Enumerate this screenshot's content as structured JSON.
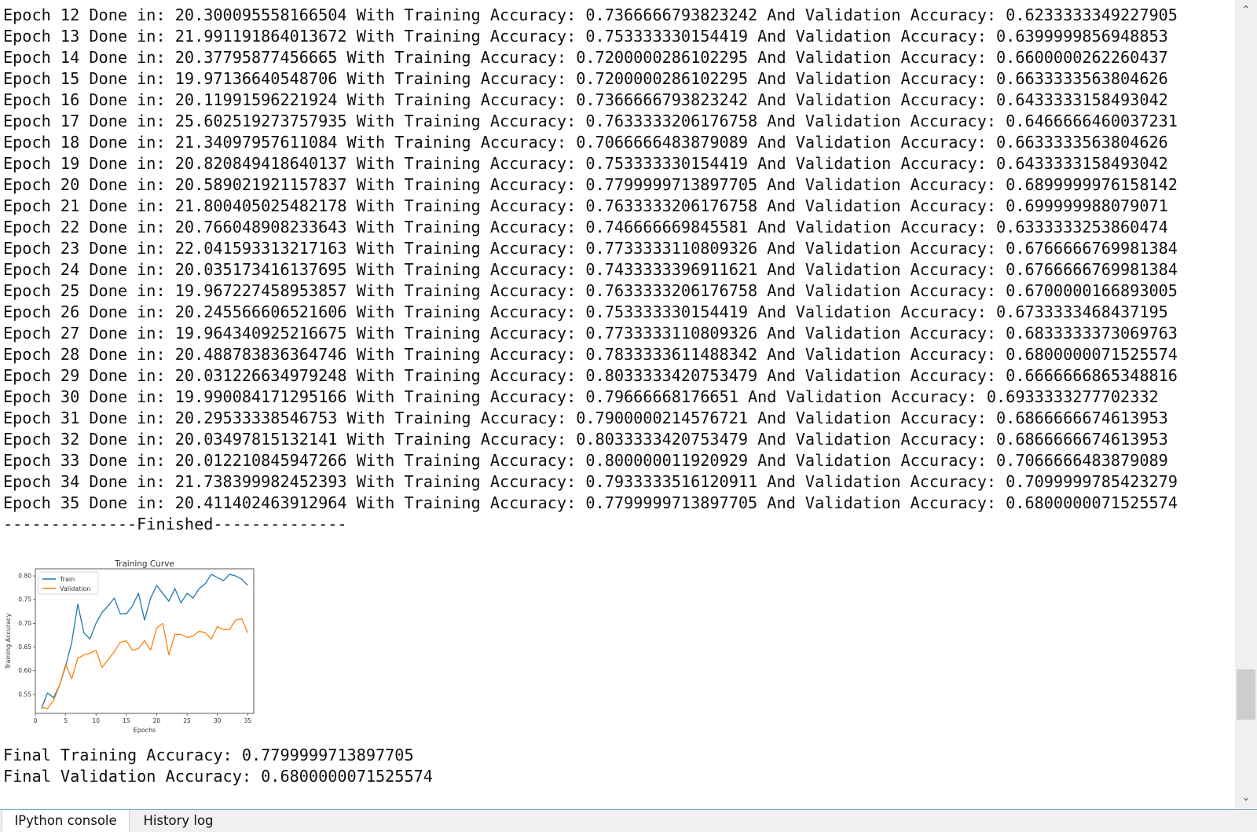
{
  "console": {
    "epoch_lines": [
      "Epoch 12 Done in: 20.300095558166504 With Training Accuracy: 0.7366666793823242 And Validation Accuracy: 0.6233333349227905",
      "Epoch 13 Done in: 21.991191864013672 With Training Accuracy: 0.753333330154419 And Validation Accuracy: 0.6399999856948853",
      "Epoch 14 Done in: 20.37795877456665 With Training Accuracy: 0.7200000286102295 And Validation Accuracy: 0.6600000262260437",
      "Epoch 15 Done in: 19.97136640548706 With Training Accuracy: 0.7200000286102295 And Validation Accuracy: 0.6633333563804626",
      "Epoch 16 Done in: 20.11991596221924 With Training Accuracy: 0.7366666793823242 And Validation Accuracy: 0.6433333158493042",
      "Epoch 17 Done in: 25.602519273757935 With Training Accuracy: 0.7633333206176758 And Validation Accuracy: 0.6466666460037231",
      "Epoch 18 Done in: 21.34097957611084 With Training Accuracy: 0.7066666483879089 And Validation Accuracy: 0.6633333563804626",
      "Epoch 19 Done in: 20.820849418640137 With Training Accuracy: 0.753333330154419 And Validation Accuracy: 0.6433333158493042",
      "Epoch 20 Done in: 20.589021921157837 With Training Accuracy: 0.7799999713897705 And Validation Accuracy: 0.6899999976158142",
      "Epoch 21 Done in: 21.800405025482178 With Training Accuracy: 0.7633333206176758 And Validation Accuracy: 0.699999988079071",
      "Epoch 22 Done in: 20.766048908233643 With Training Accuracy: 0.746666669845581 And Validation Accuracy: 0.6333333253860474",
      "Epoch 23 Done in: 22.041593313217163 With Training Accuracy: 0.7733333110809326 And Validation Accuracy: 0.6766666769981384",
      "Epoch 24 Done in: 20.035173416137695 With Training Accuracy: 0.7433333396911621 And Validation Accuracy: 0.6766666769981384",
      "Epoch 25 Done in: 19.967227458953857 With Training Accuracy: 0.7633333206176758 And Validation Accuracy: 0.6700000166893005",
      "Epoch 26 Done in: 20.245566606521606 With Training Accuracy: 0.753333330154419 And Validation Accuracy: 0.6733333468437195",
      "Epoch 27 Done in: 19.964340925216675 With Training Accuracy: 0.7733333110809326 And Validation Accuracy: 0.6833333373069763",
      "Epoch 28 Done in: 20.488783836364746 With Training Accuracy: 0.7833333611488342 And Validation Accuracy: 0.6800000071525574",
      "Epoch 29 Done in: 20.031226634979248 With Training Accuracy: 0.8033333420753479 And Validation Accuracy: 0.6666666865348816",
      "Epoch 30 Done in: 19.990084171295166 With Training Accuracy: 0.79666668176651 And Validation Accuracy: 0.6933333277702332",
      "Epoch 31 Done in: 20.29533338546753 With Training Accuracy: 0.7900000214576721 And Validation Accuracy: 0.6866666674613953",
      "Epoch 32 Done in: 20.03497815132141 With Training Accuracy: 0.8033333420753479 And Validation Accuracy: 0.6866666674613953",
      "Epoch 33 Done in: 20.012210845947266 With Training Accuracy: 0.800000011920929 And Validation Accuracy: 0.7066666483879089",
      "Epoch 34 Done in: 21.738399982452393 With Training Accuracy: 0.7933333516120911 And Validation Accuracy: 0.7099999785423279",
      "Epoch 35 Done in: 20.411402463912964 With Training Accuracy: 0.7799999713897705 And Validation Accuracy: 0.6800000071525574"
    ],
    "finished_line": "--------------Finished--------------",
    "final_training_line": "Final Training Accuracy: 0.7799999713897705",
    "final_validation_line": "Final Validation Accuracy: 0.6800000071525574"
  },
  "plot": {
    "colors": {
      "train": "#1f77b4",
      "validation": "#ff7f0e",
      "axis": "#333333",
      "text": "#333333"
    }
  },
  "chart_data": {
    "type": "line",
    "title": "Training Curve",
    "xlabel": "Epochs",
    "ylabel": "Training Accuracy",
    "xlim": [
      0,
      36
    ],
    "ylim": [
      0.51,
      0.815
    ],
    "xticks": [
      0,
      5,
      10,
      15,
      20,
      25,
      30,
      35
    ],
    "yticks": [
      0.55,
      0.6,
      0.65,
      0.7,
      0.75,
      0.8
    ],
    "ytick_labels": [
      "0.55",
      "0.60",
      "0.65",
      "0.70",
      "0.75",
      "0.80"
    ],
    "legend_position": "top-left",
    "grid": false,
    "x": [
      1,
      2,
      3,
      4,
      5,
      6,
      7,
      8,
      9,
      10,
      11,
      12,
      13,
      14,
      15,
      16,
      17,
      18,
      19,
      20,
      21,
      22,
      23,
      24,
      25,
      26,
      27,
      28,
      29,
      30,
      31,
      32,
      33,
      34,
      35
    ],
    "series": [
      {
        "name": "Train",
        "values": [
          0.52,
          0.553,
          0.543,
          0.57,
          0.61,
          0.66,
          0.74,
          0.68,
          0.667,
          0.7,
          0.723,
          0.7367,
          0.7533,
          0.72,
          0.72,
          0.7367,
          0.7633,
          0.7067,
          0.7533,
          0.78,
          0.7633,
          0.7467,
          0.7733,
          0.7433,
          0.7633,
          0.7533,
          0.7733,
          0.7833,
          0.8033,
          0.7967,
          0.79,
          0.8033,
          0.8,
          0.7933,
          0.78
        ]
      },
      {
        "name": "Validation",
        "values": [
          0.523,
          0.52,
          0.537,
          0.57,
          0.613,
          0.583,
          0.627,
          0.633,
          0.637,
          0.643,
          0.607,
          0.6233,
          0.64,
          0.66,
          0.6633,
          0.6433,
          0.6467,
          0.6633,
          0.6433,
          0.69,
          0.7,
          0.6333,
          0.6767,
          0.6767,
          0.67,
          0.6733,
          0.6833,
          0.68,
          0.6667,
          0.6933,
          0.6867,
          0.6867,
          0.7067,
          0.71,
          0.68
        ]
      }
    ]
  },
  "scrollbar": {
    "up_glyph": "⌃",
    "down_glyph": "⌄"
  },
  "tabs": [
    {
      "label": "IPython console",
      "active": true
    },
    {
      "label": "History log",
      "active": false
    }
  ]
}
